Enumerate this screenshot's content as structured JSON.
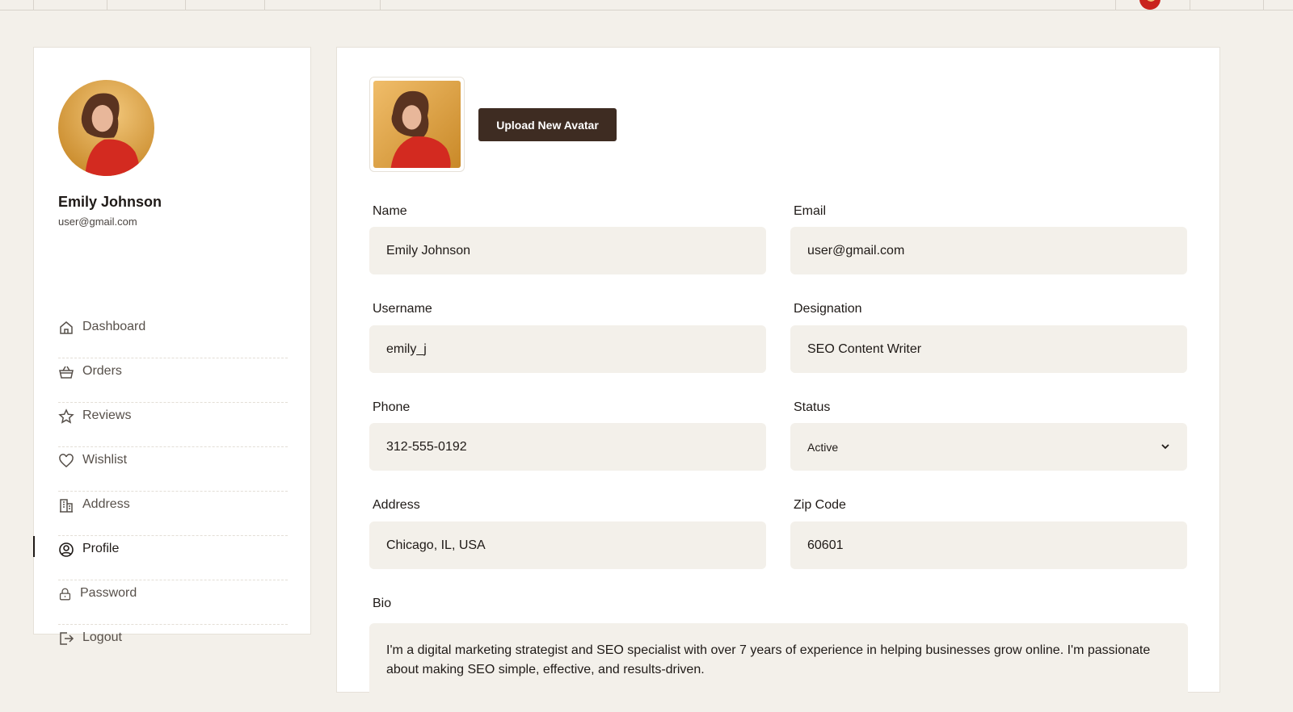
{
  "user": {
    "name": "Emily Johnson",
    "email": "user@gmail.com"
  },
  "sidebar": {
    "items": [
      {
        "label": "Dashboard",
        "icon": "home-icon"
      },
      {
        "label": "Orders",
        "icon": "basket-icon"
      },
      {
        "label": "Reviews",
        "icon": "star-icon"
      },
      {
        "label": "Wishlist",
        "icon": "heart-icon"
      },
      {
        "label": "Address",
        "icon": "building-icon"
      },
      {
        "label": "Profile",
        "icon": "user-circle-icon",
        "active": true
      },
      {
        "label": "Password",
        "icon": "lock-icon"
      },
      {
        "label": "Logout",
        "icon": "logout-icon"
      }
    ]
  },
  "profile": {
    "upload_label": "Upload New Avatar",
    "fields": {
      "name": {
        "label": "Name",
        "value": "Emily Johnson"
      },
      "email": {
        "label": "Email",
        "value": "user@gmail.com"
      },
      "username": {
        "label": "Username",
        "value": "emily_j"
      },
      "designation": {
        "label": "Designation",
        "value": "SEO Content Writer"
      },
      "phone": {
        "label": "Phone",
        "value": "312-555-0192"
      },
      "status": {
        "label": "Status",
        "value": "Active"
      },
      "address": {
        "label": "Address",
        "value": "Chicago, IL, USA"
      },
      "zip": {
        "label": "Zip Code",
        "value": "60601"
      },
      "bio": {
        "label": "Bio",
        "value": "I'm a digital marketing strategist and SEO specialist with over 7 years of experience in helping businesses grow online. I'm passionate about making SEO simple, effective, and results-driven."
      }
    }
  },
  "colors": {
    "background": "#f3f0ea",
    "button": "#3e2c22",
    "field": "#f3f0ea"
  }
}
